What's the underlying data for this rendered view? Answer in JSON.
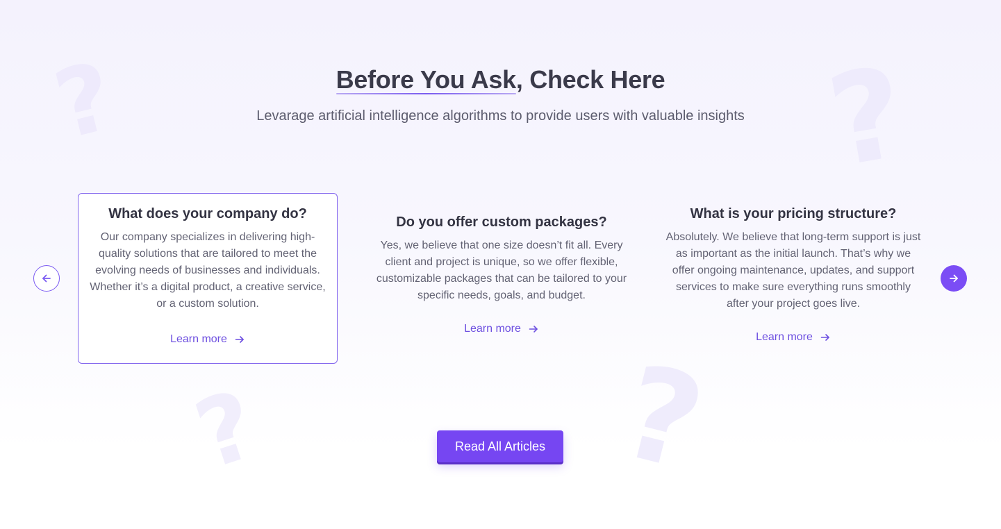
{
  "header": {
    "title_highlight": "Before You Ask",
    "title_rest": ", Check Here",
    "subtitle": "Levarage artificial intelligence algorithms to provide users with valuable insights"
  },
  "faq": [
    {
      "question": "What does your company do?",
      "answer": "Our company specializes in delivering high-quality solutions that are tailored to meet the evolving needs of businesses and individuals. Whether it’s a digital product, a creative service, or a custom solution.",
      "link": "Learn more"
    },
    {
      "question": "Do you offer custom packages?",
      "answer": "Yes, we believe that one size doesn’t fit all. Every client and project is unique, so we offer flexible, customizable packages that can be tailored to your specific needs, goals, and budget.",
      "link": "Learn more"
    },
    {
      "question": "What is your pricing structure?",
      "answer": "Absolutely. We believe that long-term support is just as important as the initial launch. That’s why we offer ongoing maintenance, updates, and support services to make sure everything runs smoothly after your project goes live.",
      "link": "Learn more"
    }
  ],
  "cta": {
    "label": "Read All Articles"
  },
  "icons": {
    "prev": "arrow-left-icon",
    "next": "arrow-right-icon",
    "link_arrow": "arrow-right-icon",
    "decoration": "question-mark-icon"
  },
  "colors": {
    "accent": "#7646f2",
    "link": "#6d4fe0",
    "heading": "#3a3a4a",
    "body_text": "#626273"
  }
}
